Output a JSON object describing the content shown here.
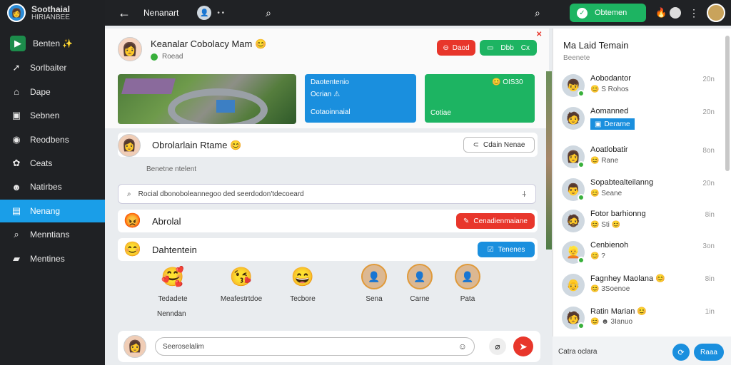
{
  "brand": {
    "title": "Soothaial",
    "subtitle": "HIRIANBEE"
  },
  "sidebar": {
    "items": [
      {
        "label": "Benten ✨",
        "icon": "▶"
      },
      {
        "label": "Sorlbaiter",
        "icon": "➚"
      },
      {
        "label": "Dape",
        "icon": "⌂"
      },
      {
        "label": "Sebnen",
        "icon": "▣"
      },
      {
        "label": "Reodbens",
        "icon": "◉"
      },
      {
        "label": "Ceats",
        "icon": "✿"
      },
      {
        "label": "Natirbes",
        "icon": "☻"
      },
      {
        "label": "Nenang",
        "icon": "▤"
      },
      {
        "label": "Menntians",
        "icon": "⌕"
      },
      {
        "label": "Mentines",
        "icon": "▰"
      }
    ]
  },
  "topbar": {
    "title": "Nenanart",
    "dots": "• •",
    "primary_button": "Obtemen"
  },
  "post": {
    "author": "Keanalar Cobolacy Mam 😊",
    "meta": "Roead",
    "red_button": "Daod",
    "green_button_a": "Dbb",
    "green_button_b": "Cx",
    "blue_tile": {
      "line1": "Daotentenio",
      "line2": "Ocrian ⚠",
      "line3": "Cotaoinnaial"
    },
    "green_tile": {
      "line1": "😊 OIS30",
      "line2": "Cotiae"
    }
  },
  "feed": {
    "row1_name": "Obrolarlain Rtame 😊",
    "row1_button": "Cdain Nenae",
    "sub_label": "Benetne ntelent",
    "search_placeholder": "Rocial dbonoboleannegoo ded seerdodon'tdecoeard",
    "row2_name": "Abrolal",
    "row2_button": "Cenadienmaiane",
    "row3_name": "Dahtentein",
    "row3_button": "Tenenes",
    "reactions": [
      {
        "label": "Tedadete",
        "face": "🥰"
      },
      {
        "label": "Meafestrtdoe",
        "face": "😘"
      },
      {
        "label": "Tecbore",
        "face": "😄"
      },
      {
        "label": "Sena",
        "face": "👤"
      },
      {
        "label": "Carne",
        "face": "👤"
      },
      {
        "label": "Pata",
        "face": "👤"
      }
    ],
    "reactions_sub": "Nenndan",
    "composer_placeholder": "Seeroselalim"
  },
  "chat": {
    "title": "Ma Laid Temain",
    "subtitle": "Beenete",
    "contacts": [
      {
        "name": "Aobodantor",
        "status": "😊 S Rohos",
        "time": "20n"
      },
      {
        "name": "Aomanned",
        "status": "Derarne",
        "time": "20n"
      },
      {
        "name": "Aoatlobatir",
        "status": "😊 Rane",
        "time": "8on"
      },
      {
        "name": "Sopabtealteilanng",
        "status": "😊 Seane",
        "time": "20n"
      },
      {
        "name": "Fotor barhionng",
        "status": "😊 Sti 😊",
        "time": "8in"
      },
      {
        "name": "Cenbienoh",
        "status": "😊 ?",
        "time": "3on"
      },
      {
        "name": "Fagnhey Maolana 😊",
        "status": "😊 3Soenoe",
        "time": "8in"
      },
      {
        "name": "Ratin Marian 😊",
        "status": "😊 ☻ 3Ianuo",
        "time": "1in"
      }
    ]
  },
  "bottom": {
    "text": "Catra oclara",
    "send": "Raaa"
  }
}
